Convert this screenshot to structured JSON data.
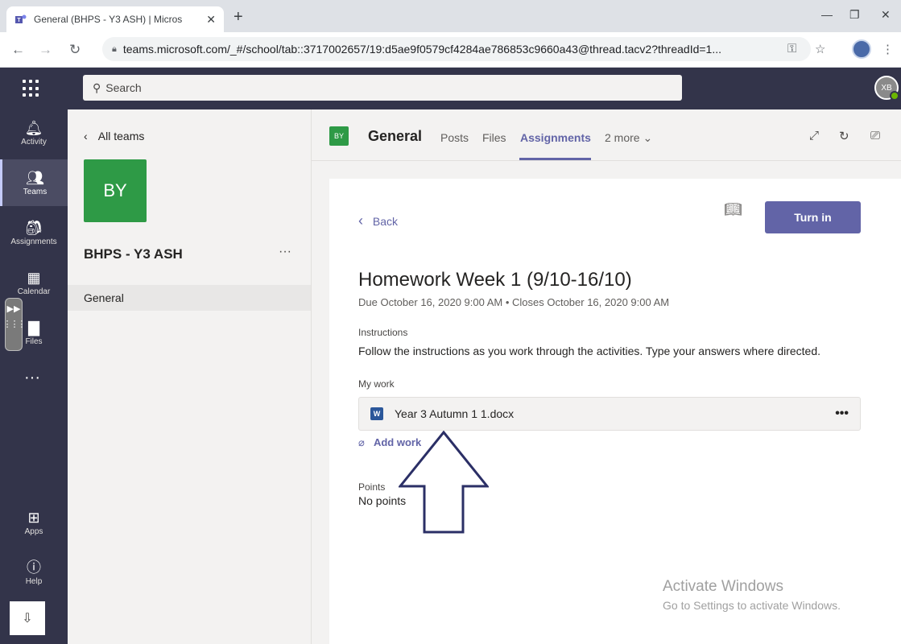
{
  "browser": {
    "tab_title": "General (BHPS - Y3 ASH) | Micros",
    "tab_close": "✕",
    "new_tab": "+",
    "url": "teams.microsoft.com/_#/school/tab::3717002657/19:d5ae9f0579cf4284ae786853c9660a43@thread.tacv2?threadId=1...",
    "minimize": "—",
    "restore": "❐",
    "close": "✕"
  },
  "teams": {
    "search_placeholder": "Search",
    "avatar_initials": "XB"
  },
  "rail": {
    "items": [
      {
        "label": "Activity",
        "icon": "bell-icon"
      },
      {
        "label": "Teams",
        "icon": "teams-icon"
      },
      {
        "label": "Assignments",
        "icon": "assignments-icon"
      },
      {
        "label": "Calendar",
        "icon": "calendar-icon"
      },
      {
        "label": "Files",
        "icon": "files-icon"
      },
      {
        "label": "Apps",
        "icon": "apps-icon"
      },
      {
        "label": "Help",
        "icon": "help-icon"
      }
    ],
    "more": "···"
  },
  "left_pane": {
    "back_label": "All teams",
    "team_initials": "BY",
    "team_name": "BHPS - Y3 ASH",
    "more": "···",
    "channel": "General"
  },
  "channel_header": {
    "avatar": "BY",
    "title": "General",
    "tabs": [
      "Posts",
      "Files",
      "Assignments",
      "2 more"
    ],
    "active_tab": "Assignments"
  },
  "assignment": {
    "back_label": "Back",
    "turn_in_label": "Turn in",
    "title": "Homework Week 1 (9/10-16/10)",
    "dates": "Due October 16, 2020 9:00 AM  •  Closes October 16, 2020 9:00 AM",
    "instructions_label": "Instructions",
    "instructions_text": "Follow the instructions as you work through the activities. Type your answers where directed.",
    "my_work_label": "My work",
    "file_name": "Year 3 Autumn 1 1.docx",
    "file_more": "•••",
    "add_work_label": "Add work",
    "points_label": "Points",
    "points_value": "No points"
  },
  "watermark": {
    "line1": "Activate Windows",
    "line2": "Go to Settings to activate Windows."
  },
  "colors": {
    "teams_purple": "#6264a7",
    "rail_bg": "#33344a",
    "team_green": "#2e9a46"
  }
}
